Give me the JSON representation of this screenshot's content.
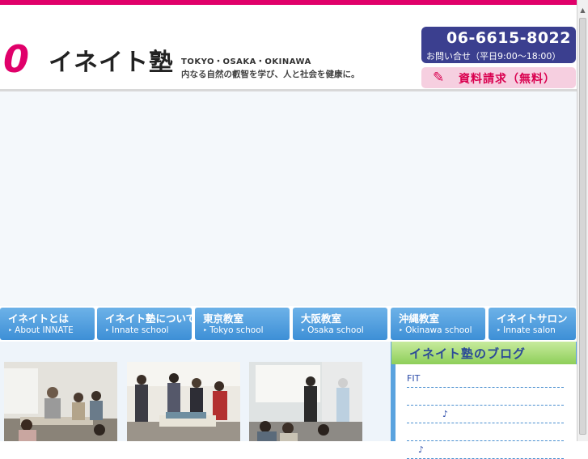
{
  "header": {
    "logo_mark": "0",
    "logo_name": "イネイト塾",
    "cities": "TOKYO・OSAKA・OKINAWA",
    "tagline": "内なる自然の叡智を学び、人と社会を健康に。",
    "phone": "06-6615-8022",
    "hours": "お問い合せ（平日9:00〜18:00）",
    "request_label": "資料請求（無料）",
    "request_icon": "pencil-note-icon",
    "accent_color": "#e0006a",
    "contact_bg": "#3b3f8f"
  },
  "nav": [
    {
      "label": "イネイトとは",
      "sub": "About INNATE"
    },
    {
      "label": "イネイト塾について",
      "sub": "Innate school"
    },
    {
      "label": "東京教室",
      "sub": "Tokyo school"
    },
    {
      "label": "大阪教室",
      "sub": "Osaka school"
    },
    {
      "label": "沖縄教室",
      "sub": "Okinawa school"
    },
    {
      "label": "イネイトサロン",
      "sub": "Innate salon"
    }
  ],
  "blog": {
    "title": "イネイト塾のブログ",
    "entries": [
      "FIT",
      "",
      "♪",
      "",
      "♪"
    ]
  }
}
